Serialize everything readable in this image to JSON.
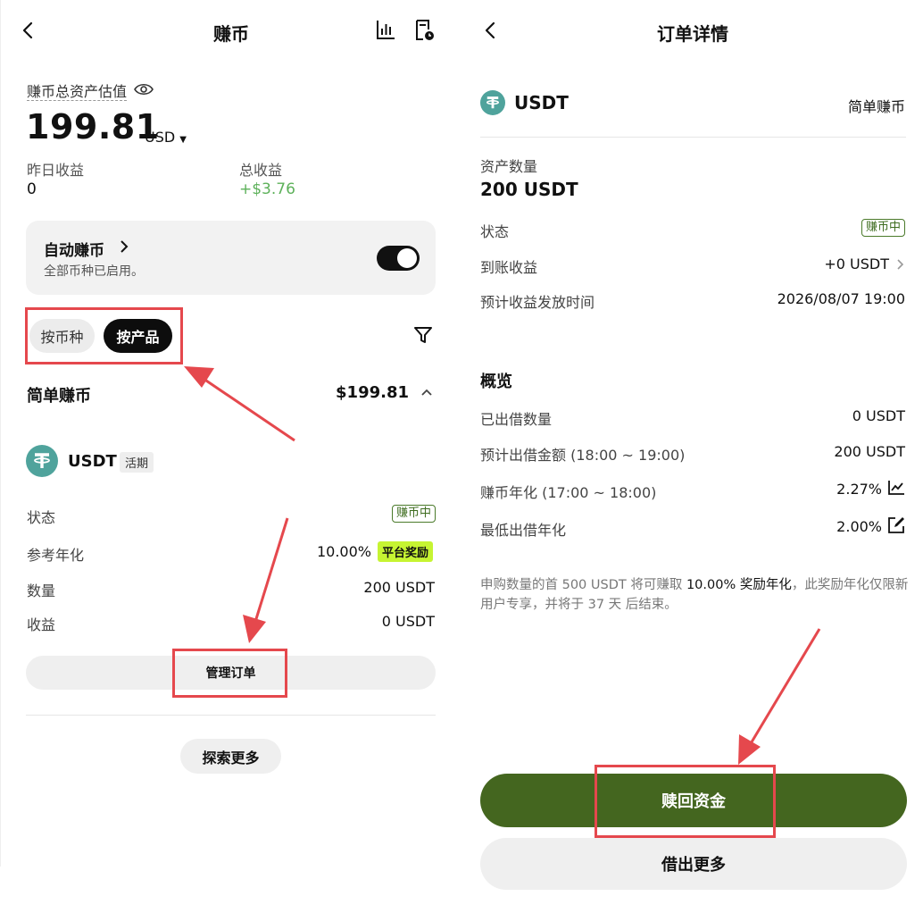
{
  "left": {
    "header": {
      "title": "赚币"
    },
    "assets": {
      "label": "赚币总资产估值",
      "amount": "199.81",
      "currency": "USD",
      "yesterday_label": "昨日收益",
      "yesterday_value": "0",
      "total_label": "总收益",
      "total_value": "+$3.76"
    },
    "auto_earn": {
      "title": "自动赚币",
      "subtitle": "全部币种已启用。",
      "enabled": true
    },
    "tabs": [
      {
        "label": "按币种"
      },
      {
        "label": "按产品"
      }
    ],
    "product": {
      "name": "简单赚币",
      "total": "$199.81",
      "coin": "USDT",
      "coin_tag": "活期",
      "rows": {
        "status_label": "状态",
        "status_value": "赚币中",
        "apr_label": "参考年化",
        "apr_value": "10.00%",
        "apr_tag": "平台奖励",
        "qty_label": "数量",
        "qty_value": "200 USDT",
        "earn_label": "收益",
        "earn_value": "0 USDT"
      },
      "manage_label": "管理订单"
    },
    "explore_label": "探索更多"
  },
  "right": {
    "header": {
      "title": "订单详情"
    },
    "coin": "USDT",
    "product_name": "简单赚币",
    "amount_label": "资产数量",
    "amount_value": "200 USDT",
    "status_label": "状态",
    "status_value": "赚币中",
    "received_label": "到账收益",
    "received_value": "+0 USDT",
    "payout_label": "预计收益发放时间",
    "payout_value": "2026/08/07 19:00",
    "overview_title": "概览",
    "overview": [
      {
        "label": "已出借数量",
        "value": "0 USDT"
      },
      {
        "label": "预计出借金额 (18:00 ~ 19:00)",
        "value": "200 USDT"
      },
      {
        "label": "赚币年化 (17:00 ~ 18:00)",
        "value": "2.27%"
      },
      {
        "label": "最低出借年化",
        "value": "2.00%"
      }
    ],
    "note": {
      "part1": "申购数量的首 500 USDT 将可赚取 ",
      "highlight": "10.00% 奖励年化",
      "part2": "，此奖励年化仅限新用户专享，并将于 37 天 后结束。"
    },
    "redeem_label": "赎回资金",
    "lend_more_label": "借出更多"
  },
  "colors": {
    "accent_green": "#44661f",
    "positive": "#5db15a",
    "highlight_red": "#e5484d",
    "lime_tag": "#c6f432"
  }
}
